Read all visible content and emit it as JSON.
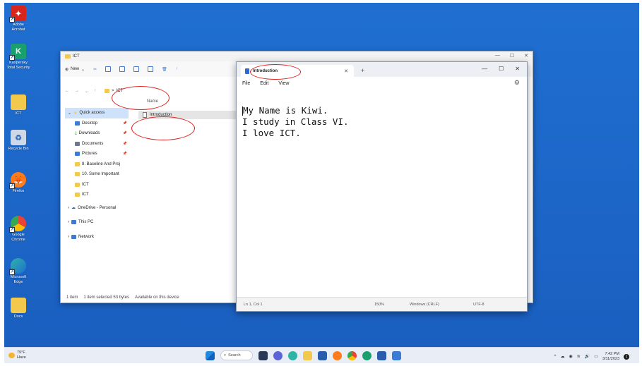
{
  "desktop": {
    "icons": [
      {
        "label_line1": "Adobe",
        "label_line2": "Acrobat",
        "color": "#d7261e"
      },
      {
        "label_line1": "Kaspersky",
        "label_line2": "Total Security",
        "color": "#1aa06d"
      },
      {
        "label_line1": "ICT",
        "label_line2": "",
        "color": "#f2c94c"
      },
      {
        "label_line1": "Recycle Bin",
        "label_line2": "",
        "color": "#cfd8e6"
      },
      {
        "label_line1": "Firefox",
        "label_line2": "",
        "color": "#ff7a18"
      },
      {
        "label_line1": "Google",
        "label_line2": "Chrome",
        "color": "#34a853"
      },
      {
        "label_line1": "Microsoft",
        "label_line2": "Edge",
        "color": "#2fb3a6"
      },
      {
        "label_line1": "Docs",
        "label_line2": "",
        "color": "#f2c94c"
      }
    ]
  },
  "explorer": {
    "title": "ICT",
    "toolbar": {
      "new_label": "New"
    },
    "address": {
      "sep": ">",
      "folder": "ICT"
    },
    "column_name": "Name",
    "nav": [
      {
        "label": "Quick access",
        "level": "top",
        "icon": "star-icon",
        "color": "#f2c94c"
      },
      {
        "label": "Desktop",
        "level": "sub",
        "icon": "desktop-icon",
        "color": "#3a7bd5",
        "pinned": true
      },
      {
        "label": "Downloads",
        "level": "sub",
        "icon": "download-icon",
        "color": "#1a8a3c",
        "pinned": true
      },
      {
        "label": "Documents",
        "level": "sub",
        "icon": "document-icon",
        "color": "#6d7a8c",
        "pinned": true
      },
      {
        "label": "Pictures",
        "level": "sub",
        "icon": "picture-icon",
        "color": "#3a7bd5",
        "pinned": true
      },
      {
        "label": "8. Baseline And Proj",
        "level": "sub",
        "icon": "folder-icon",
        "color": "#f2c94c"
      },
      {
        "label": "10. Some Important",
        "level": "sub",
        "icon": "folder-icon",
        "color": "#f2c94c"
      },
      {
        "label": "ICT",
        "level": "sub",
        "icon": "folder-icon",
        "color": "#f2c94c"
      },
      {
        "label": "ICT",
        "level": "sub",
        "icon": "folder-icon",
        "color": "#f2c94c"
      },
      {
        "label": "OneDrive - Personal",
        "level": "top",
        "icon": "cloud-icon",
        "color": "#1f6fd1"
      },
      {
        "label": "This PC",
        "level": "top",
        "icon": "monitor-icon",
        "color": "#3a7bd5"
      },
      {
        "label": "Network",
        "level": "top",
        "icon": "network-icon",
        "color": "#3a7bd5"
      }
    ],
    "file": {
      "name": "Introduction"
    },
    "status": {
      "count": "1 item",
      "selected": "1 item selected  53 bytes",
      "availability": "Available on this device"
    }
  },
  "notepad": {
    "tab_title": "Introduction",
    "menu": [
      "File",
      "Edit",
      "View"
    ],
    "lines": [
      "My Name is Kiwi.",
      "I study in Class VI.",
      "I love ICT."
    ],
    "status": {
      "position": "Ln 1, Col 1",
      "zoom": "150%",
      "line_ending": "Windows (CRLF)",
      "encoding": "UTF-8"
    }
  },
  "taskbar": {
    "weather_temp": "79°F",
    "weather_desc": "Haze",
    "search_label": "Search",
    "time": "7:42 PM",
    "date": "3/11/2023",
    "notification_count": "1"
  },
  "colors": {
    "annotation": "#e0201c",
    "accent": "#1f6fd1"
  }
}
